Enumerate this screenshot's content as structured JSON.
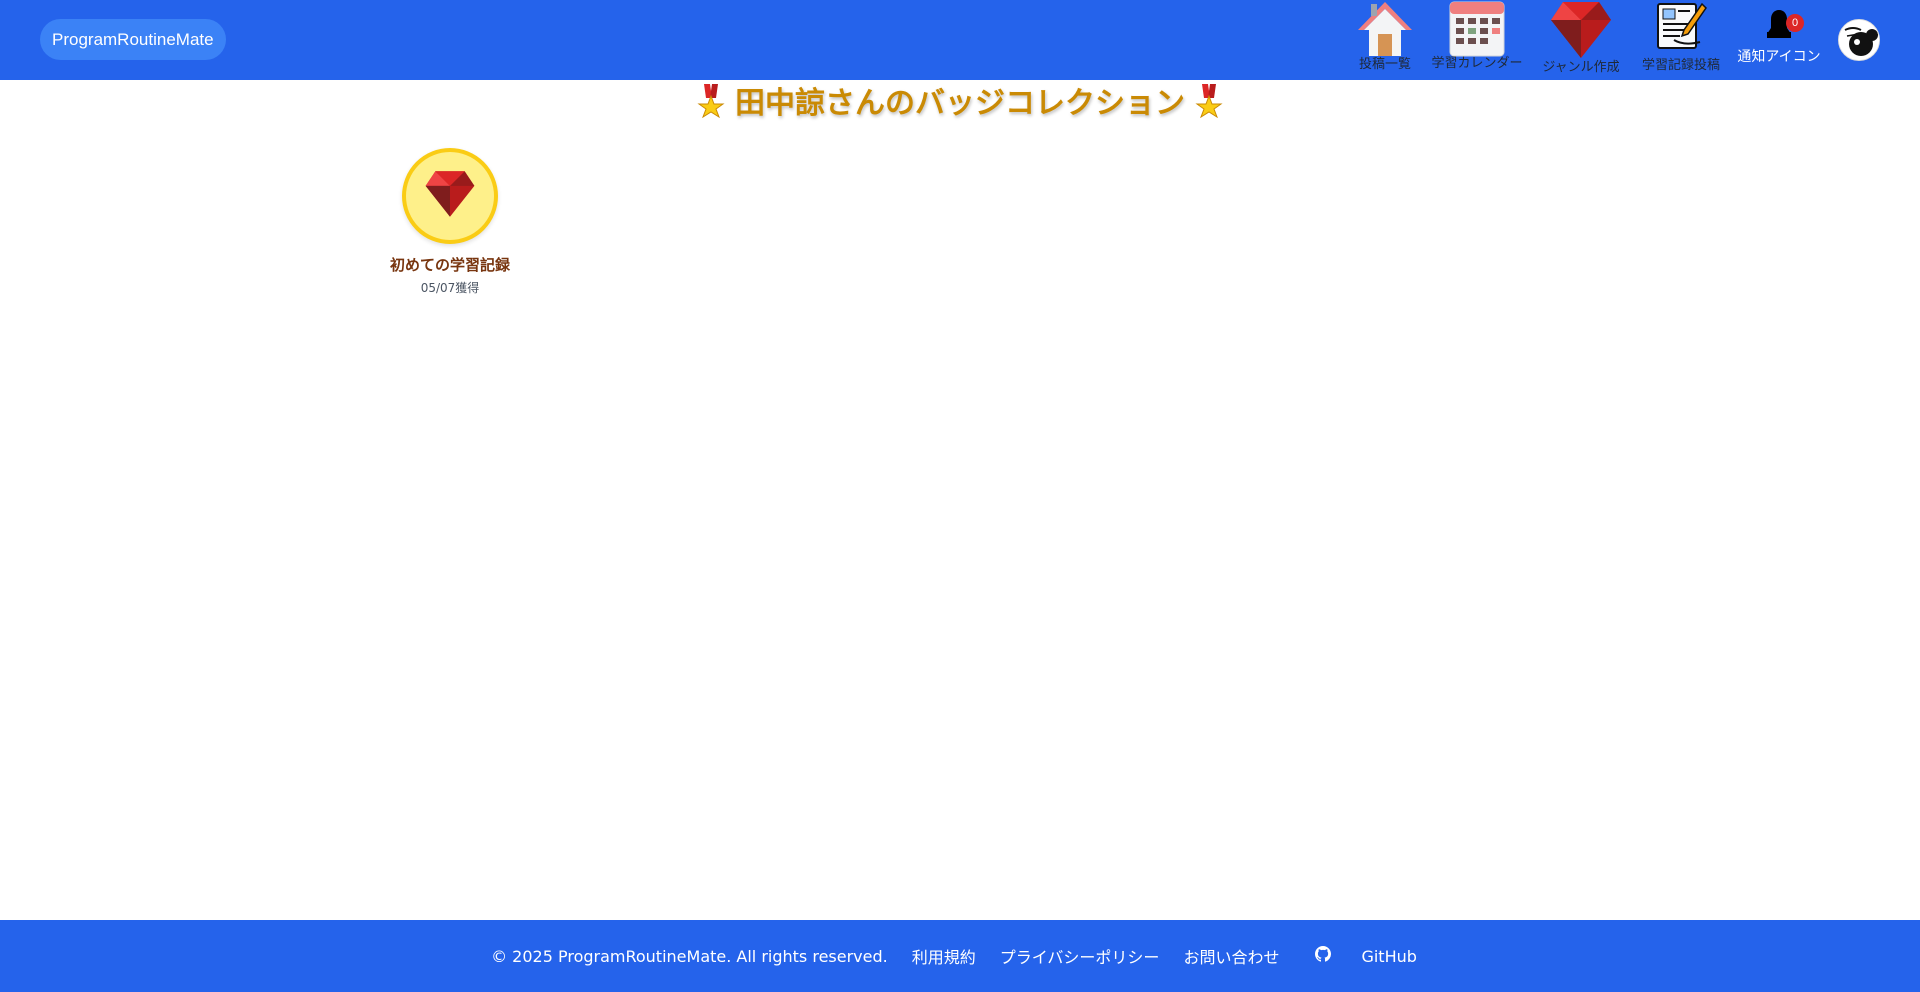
{
  "header": {
    "brand": "ProgramRoutineMate",
    "nav": [
      {
        "label": "投稿一覧",
        "icon": "house-icon"
      },
      {
        "label": "学習カレンダー",
        "icon": "calendar-icon"
      },
      {
        "label": "ジャンル作成",
        "icon": "ruby-gem-icon"
      },
      {
        "label": "学習記録投稿",
        "icon": "memo-pencil-icon"
      },
      {
        "label": "通知アイコン",
        "icon": "bell-icon"
      }
    ],
    "notification_count": "0",
    "avatar_icon": "avatar-icon"
  },
  "page": {
    "title": "田中諒さんのバッジコレクション",
    "title_icon": "medal-icon"
  },
  "badges": [
    {
      "name": "初めての学習記録",
      "earned": "05/07獲得",
      "icon": "ruby-gem-icon"
    }
  ],
  "footer": {
    "copyright": "© 2025 ProgramRoutineMate. All rights reserved.",
    "terms": "利用規約",
    "privacy": "プライバシーポリシー",
    "contact": "お問い合わせ",
    "github": "GitHub"
  },
  "colors": {
    "primary": "#2563eb",
    "brand_pill": "#3b82f6",
    "title": "#ca8a04",
    "badge_bg": "#fef08a",
    "badge_border": "#facc15",
    "notification_badge": "#dc2626"
  }
}
